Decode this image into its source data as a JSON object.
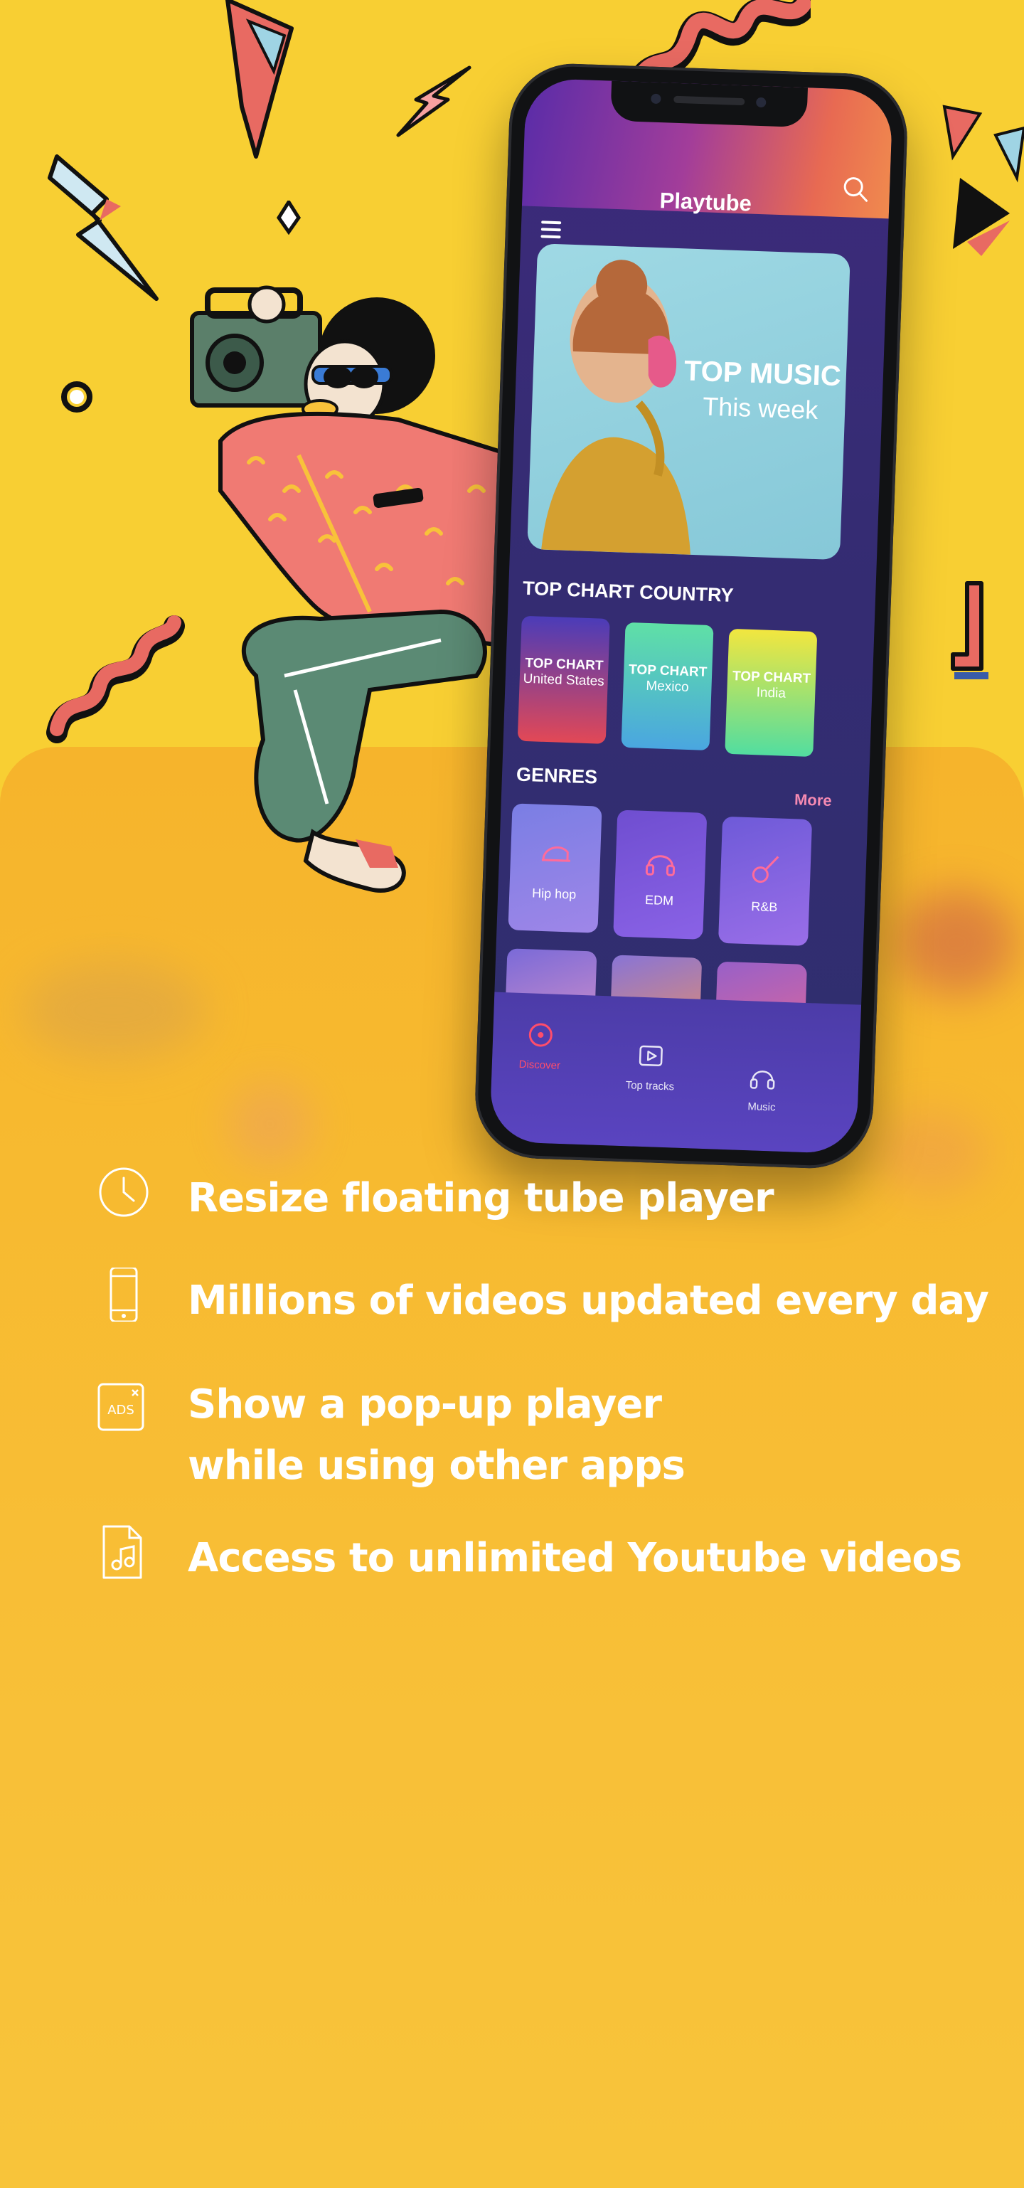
{
  "app": {
    "title": "Playtube",
    "hero": {
      "title": "TOP MUSIC",
      "subtitle": "This week"
    },
    "top_chart": {
      "heading": "TOP CHART COUNTRY",
      "cards": [
        {
          "line1": "TOP CHART",
          "line2": "United States"
        },
        {
          "line1": "TOP CHART",
          "line2": "Mexico"
        },
        {
          "line1": "TOP CHART",
          "line2": "India"
        }
      ]
    },
    "genres": {
      "heading": "GENRES",
      "more_label": "More",
      "items": [
        {
          "label": "Hip hop",
          "icon": "cap-icon"
        },
        {
          "label": "EDM",
          "icon": "headphones-icon"
        },
        {
          "label": "R&B",
          "icon": "guitar-icon"
        }
      ]
    },
    "bottom_nav": [
      {
        "label": "Discover",
        "icon": "disc-icon",
        "active": true
      },
      {
        "label": "Top tracks",
        "icon": "play-icon",
        "active": false
      },
      {
        "label": "Music",
        "icon": "headphones-icon",
        "active": false
      }
    ]
  },
  "features": [
    {
      "icon": "clock-icon",
      "text": "Resize floating tube player"
    },
    {
      "icon": "phone-icon",
      "text": "Millions of videos updated every day"
    },
    {
      "icon": "ads-icon",
      "text_line1": "Show a pop-up player",
      "text_line2": "while using other apps"
    },
    {
      "icon": "music-file-icon",
      "text": "Access to unlimited Youtube videos"
    }
  ],
  "colors": {
    "background_top": "#f8cf33",
    "background_panel": "#f6b42c",
    "header_gradient_start": "#5a2ca8",
    "header_gradient_end": "#f08a4e",
    "accent_pink": "#f58ab2",
    "active_nav": "#ff4d6b"
  }
}
